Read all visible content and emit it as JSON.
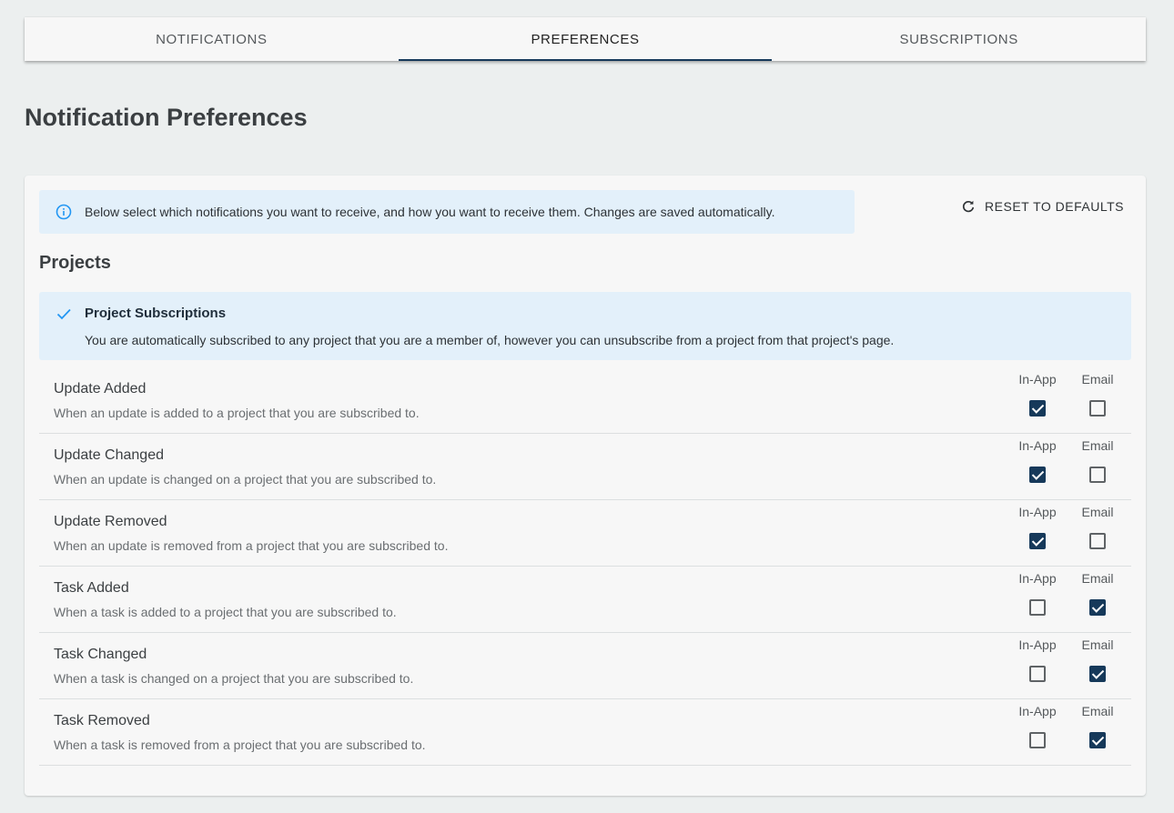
{
  "tabs": [
    {
      "label": "NOTIFICATIONS",
      "active": false
    },
    {
      "label": "PREFERENCES",
      "active": true
    },
    {
      "label": "SUBSCRIPTIONS",
      "active": false
    }
  ],
  "page_title": "Notification Preferences",
  "info_banner": {
    "icon": "info-icon",
    "text": "Below select which notifications you want to receive, and how you want to receive them. Changes are saved automatically."
  },
  "reset_button": {
    "icon": "refresh-icon",
    "label": "RESET TO DEFAULTS"
  },
  "section_title": "Projects",
  "subscription_banner": {
    "icon": "check-icon",
    "title": "Project Subscriptions",
    "text": "You are automatically subscribed to any project that you are a member of, however you can unsubscribe from a project from that project's page."
  },
  "column_labels": {
    "in_app": "In-App",
    "email": "Email"
  },
  "colors": {
    "accent": "#16395a",
    "banner": "#e3f0fa",
    "background": "#ecefef"
  },
  "preferences": [
    {
      "name": "Update Added",
      "description": "When an update is added to a project that you are subscribed to.",
      "in_app": true,
      "email": false
    },
    {
      "name": "Update Changed",
      "description": "When an update is changed on a project that you are subscribed to.",
      "in_app": true,
      "email": false
    },
    {
      "name": "Update Removed",
      "description": "When an update is removed from a project that you are subscribed to.",
      "in_app": true,
      "email": false
    },
    {
      "name": "Task Added",
      "description": "When a task is added to a project that you are subscribed to.",
      "in_app": false,
      "email": true
    },
    {
      "name": "Task Changed",
      "description": "When a task is changed on a project that you are subscribed to.",
      "in_app": false,
      "email": true
    },
    {
      "name": "Task Removed",
      "description": "When a task is removed from a project that you are subscribed to.",
      "in_app": false,
      "email": true
    }
  ]
}
